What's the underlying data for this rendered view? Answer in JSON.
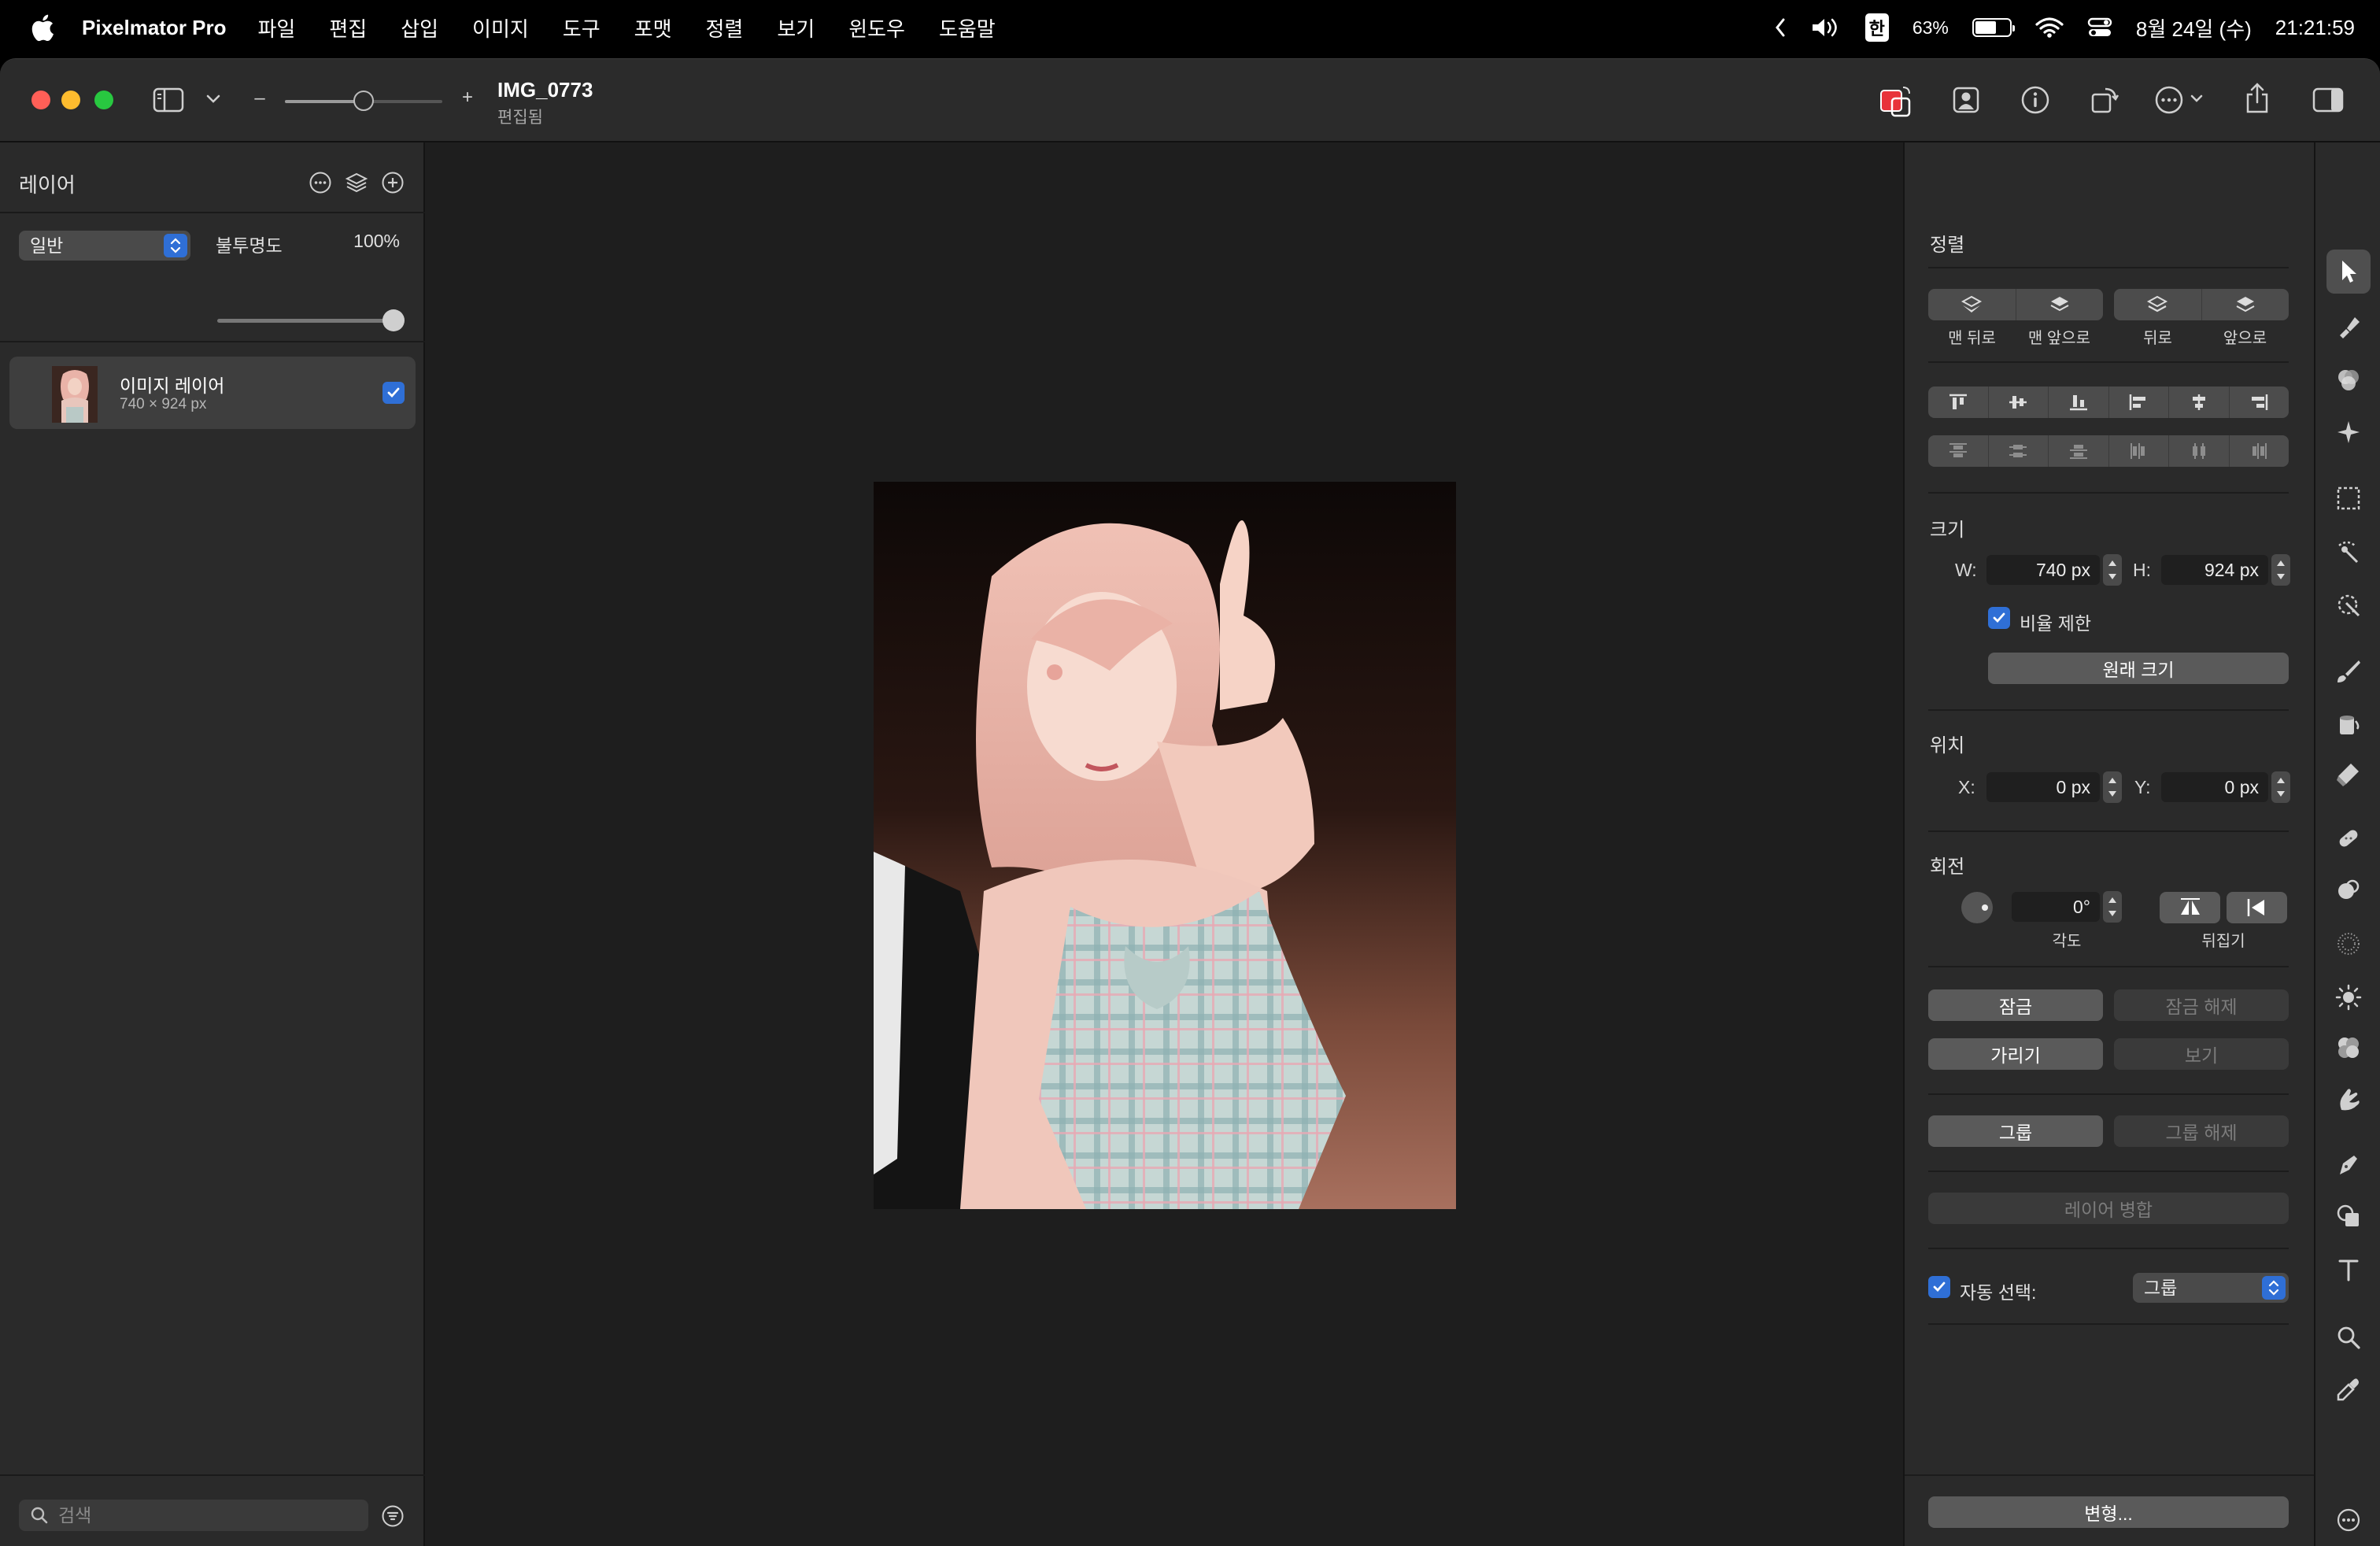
{
  "menubar": {
    "app_name": "Pixelmator Pro",
    "items": [
      "파일",
      "편집",
      "삽입",
      "이미지",
      "도구",
      "포맷",
      "정렬",
      "보기",
      "윈도우",
      "도움말"
    ],
    "input_source": "한",
    "battery_text": "63%",
    "battery_level": 0.63,
    "date": "8월 24일 (수)",
    "time": "21:21:59"
  },
  "titlebar": {
    "doc_title": "IMG_0773",
    "doc_status": "편집됨",
    "zoom_minus": "–",
    "zoom_plus": "+",
    "zoom_level": 0.5
  },
  "layers": {
    "title": "레이어",
    "blend_mode": "일반",
    "opacity_label": "불투명도",
    "opacity_value": "100%",
    "opacity_level": 1.0,
    "items": [
      {
        "name": "이미지 레이어",
        "dims": "740 × 924 px",
        "visible": true
      }
    ],
    "search_placeholder": "검색"
  },
  "arrange": {
    "title": "정렬",
    "order_captions": [
      "맨 뒤로",
      "맨 앞으로",
      "뒤로",
      "앞으로"
    ],
    "size_title": "크기",
    "w_label": "W:",
    "w_value": "740 px",
    "h_label": "H:",
    "h_value": "924 px",
    "constrain_label": "비율 제한",
    "original_size_button": "원래 크기",
    "position_title": "위치",
    "x_label": "X:",
    "x_value": "0 px",
    "y_label": "Y:",
    "y_value": "0 px",
    "rotate_title": "회전",
    "angle_value": "0°",
    "angle_caption": "각도",
    "flip_caption": "뒤집기",
    "lock_button": "잠금",
    "unlock_button": "잠금 해제",
    "hide_button": "가리기",
    "show_button": "보기",
    "group_button": "그룹",
    "ungroup_button": "그룹 해제",
    "merge_button": "레이어 병합",
    "auto_select_label": "자동 선택:",
    "auto_select_value": "그룹",
    "transform_button": "변형..."
  },
  "colors": {
    "accent": "#2f6fd6",
    "window_bg": "#1e1e1e",
    "panel_bg": "#2a2a2a"
  },
  "tools": [
    "arrange-tool-icon",
    "style-tool-icon",
    "color-adjust-icon",
    "effects-icon",
    "rect-select-icon",
    "quick-select-icon",
    "magic-select-icon",
    "paint-icon",
    "fill-icon",
    "erase-icon",
    "retouch-icon",
    "warp-icon",
    "sharpen-icon",
    "lighten-icon",
    "color-replace-icon",
    "smudge-icon",
    "pen-icon",
    "shape-icon",
    "type-icon",
    "zoom-icon",
    "eyedropper-icon",
    "more-tools-icon"
  ]
}
